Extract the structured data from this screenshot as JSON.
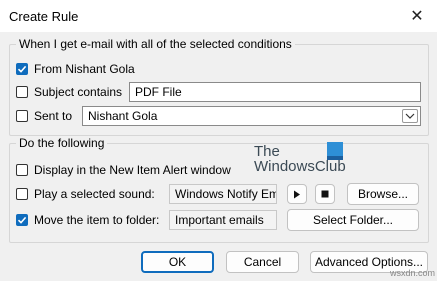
{
  "window": {
    "title": "Create Rule",
    "close_glyph": "✕"
  },
  "conditions": {
    "group_label": "When I get e-mail with all of the selected conditions",
    "from_label": "From Nishant Gola",
    "from_checked": true,
    "subject_label": "Subject contains",
    "subject_checked": false,
    "subject_value": "PDF File",
    "sent_to_label": "Sent to",
    "sent_to_checked": false,
    "sent_to_value": "Nishant Gola"
  },
  "actions": {
    "group_label": "Do the following",
    "alert_label": "Display in the New Item Alert window",
    "alert_checked": false,
    "sound_label": "Play a selected sound:",
    "sound_checked": false,
    "sound_value": "Windows Notify Em",
    "browse_label": "Browse...",
    "move_label": "Move the item to folder:",
    "move_checked": true,
    "folder_value": "Important emails",
    "select_folder_label": "Select Folder..."
  },
  "watermark": {
    "line1": "The",
    "line2": "WindowsClub"
  },
  "footer": {
    "ok_label": "OK",
    "cancel_label": "Cancel",
    "advanced_label": "Advanced Options..."
  },
  "corner_watermark": "wsxdn.com",
  "colors": {
    "accent": "#0f6cbd",
    "background": "#f0f0f0"
  }
}
